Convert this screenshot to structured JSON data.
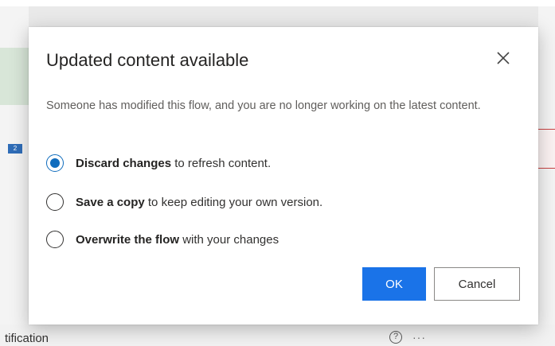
{
  "dialog": {
    "title": "Updated content available",
    "description": "Someone has modified this flow, and you are no longer working on the latest content.",
    "options": [
      {
        "bold": "Discard changes",
        "rest": " to refresh content.",
        "checked": true
      },
      {
        "bold": "Save a copy",
        "rest": " to keep editing your own version.",
        "checked": false
      },
      {
        "bold": "Overwrite the flow",
        "rest": " with your changes",
        "checked": false
      }
    ],
    "ok_label": "OK",
    "cancel_label": "Cancel"
  },
  "background": {
    "bottom_label": "tification",
    "chip_text": "2",
    "help_glyph": "?",
    "more_glyph": "···"
  },
  "colors": {
    "accent": "#1a73e8",
    "radio_accent": "#0f6cbd"
  }
}
